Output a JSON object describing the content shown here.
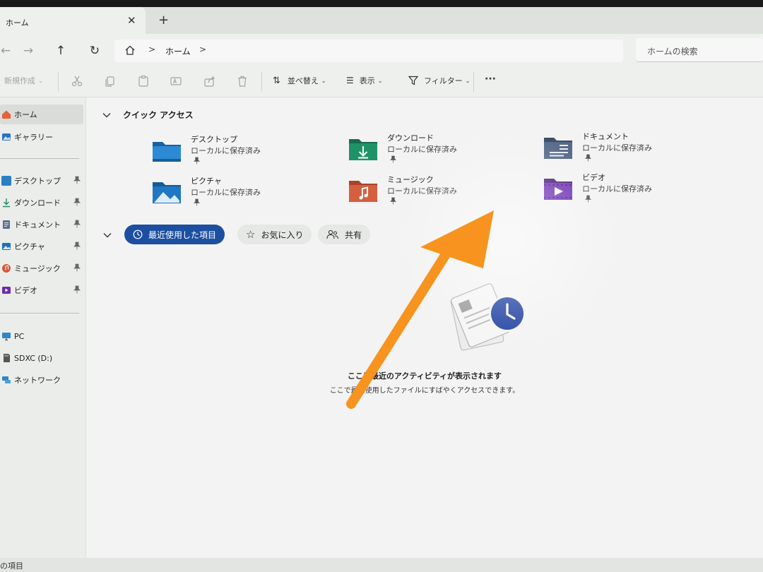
{
  "window": {
    "tab_title": "ホーム",
    "tab_close_icon": "close-icon",
    "new_tab_icon": "plus-icon"
  },
  "nav": {
    "back_icon": "arrow-left-icon",
    "forward_icon": "arrow-right-icon",
    "up_icon": "arrow-up-icon",
    "refresh_icon": "refresh-icon",
    "breadcrumb_home_icon": "home-icon",
    "breadcrumb": [
      "ホーム"
    ],
    "search_placeholder": "ホームの検索"
  },
  "toolbar": {
    "new_label": "新規作成",
    "sort_label": "並べ替え",
    "view_label": "表示",
    "filter_label": "フィルター",
    "more_label": "···"
  },
  "sidebar": {
    "items": [
      {
        "label": "ホーム",
        "icon": "home-icon",
        "selected": true
      },
      {
        "label": "ギャラリー",
        "icon": "gallery-icon"
      }
    ],
    "pinned": [
      {
        "label": "デスクトップ",
        "icon": "desktop-folder-icon"
      },
      {
        "label": "ダウンロード",
        "icon": "download-icon"
      },
      {
        "label": "ドキュメント",
        "icon": "documents-icon"
      },
      {
        "label": "ピクチャ",
        "icon": "pictures-icon"
      },
      {
        "label": "ミュージック",
        "icon": "music-icon"
      },
      {
        "label": "ビデオ",
        "icon": "video-icon"
      }
    ],
    "devices": [
      {
        "label": "PC",
        "icon": "pc-icon"
      },
      {
        "label": "SDXC (D:)",
        "icon": "sd-card-icon"
      },
      {
        "label": "ネットワーク",
        "icon": "network-icon"
      }
    ]
  },
  "quick_access": {
    "title": "クイック アクセス",
    "items": [
      {
        "name": "デスクトップ",
        "sub": "ローカルに保存済み",
        "icon": "desktop-folder-icon"
      },
      {
        "name": "ダウンロード",
        "sub": "ローカルに保存済み",
        "icon": "download-folder-icon"
      },
      {
        "name": "ドキュメント",
        "sub": "ローカルに保存済み",
        "icon": "documents-folder-icon"
      },
      {
        "name": "ピクチャ",
        "sub": "ローカルに保存済み",
        "icon": "pictures-folder-icon"
      },
      {
        "name": "ミュージック",
        "sub": "ローカルに保存済み",
        "icon": "music-folder-icon"
      },
      {
        "name": "ビデオ",
        "sub": "ローカルに保存済み",
        "icon": "video-folder-icon"
      }
    ]
  },
  "recent": {
    "tabs": [
      {
        "label": "最近使用した項目",
        "icon": "clock-icon",
        "active": true
      },
      {
        "label": "お気に入り",
        "icon": "star-icon"
      },
      {
        "label": "共有",
        "icon": "people-icon"
      }
    ],
    "empty_title": "ここに最近のアクティビティが表示されます",
    "empty_sub": "ここで最近使用したファイルにすばやくアクセスできます。"
  },
  "status": {
    "text": "の項目"
  },
  "colors": {
    "accent": "#1c4fa0",
    "annotation_arrow": "#f7931e"
  }
}
